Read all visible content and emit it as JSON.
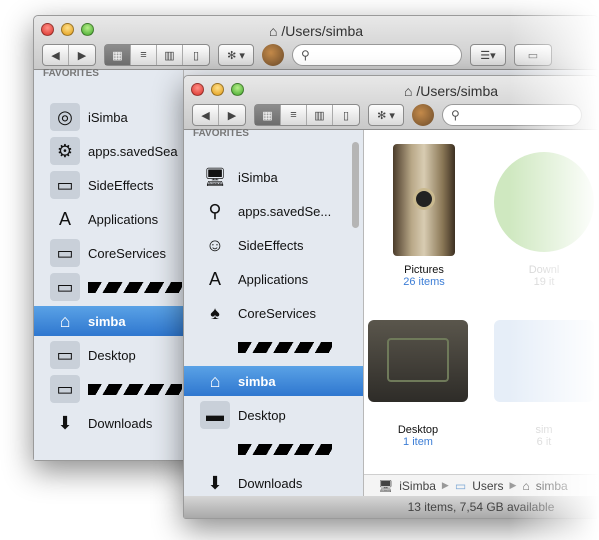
{
  "back_window": {
    "title": "/Users/simba",
    "search_placeholder": "",
    "favorites_label": "FAVORITES",
    "sidebar": [
      {
        "label": "iSimba",
        "icon": "hard-drive-icon"
      },
      {
        "label": "apps.savedSea",
        "icon": "gear-icon"
      },
      {
        "label": "SideEffects",
        "icon": "folder-icon"
      },
      {
        "label": "Applications",
        "icon": "applications-icon"
      },
      {
        "label": "CoreServices",
        "icon": "folder-icon"
      },
      {
        "label": "",
        "icon": "folder-icon"
      },
      {
        "label": "simba",
        "icon": "home-icon"
      },
      {
        "label": "Desktop",
        "icon": "desktop-icon"
      },
      {
        "label": "",
        "icon": "folder-icon"
      },
      {
        "label": "Downloads",
        "icon": "downloads-icon"
      }
    ]
  },
  "front_window": {
    "title": "/Users/simba",
    "favorites_label": "FAVORITES",
    "sidebar": [
      {
        "label": "iSimba",
        "icon": "imac-icon"
      },
      {
        "label": "apps.savedSe...",
        "icon": "magnifier-icon"
      },
      {
        "label": "SideEffects",
        "icon": "finder-icon"
      },
      {
        "label": "Applications",
        "icon": "applications-icon"
      },
      {
        "label": "CoreServices",
        "icon": "tuxedo-icon"
      },
      {
        "label": "",
        "icon": ""
      },
      {
        "label": "simba",
        "icon": "home-icon"
      },
      {
        "label": "Desktop",
        "icon": "desktop-folder-icon"
      },
      {
        "label": "",
        "icon": ""
      },
      {
        "label": "Downloads",
        "icon": "downloads-icon"
      }
    ],
    "files": [
      {
        "name": "Pictures",
        "count": "26 items"
      },
      {
        "name": "Downl",
        "count": "19 it"
      },
      {
        "name": "Desktop",
        "count": "1 item"
      },
      {
        "name": "sim",
        "count": "6 it"
      }
    ],
    "path": [
      "iSimba",
      "Users",
      "simba"
    ],
    "status": "13 items, 7,54 GB available"
  },
  "toolbar": {
    "back": "◀",
    "forward": "▶",
    "views": [
      "▦",
      "≡",
      "▥",
      "▯"
    ],
    "action": "✻ ▾",
    "search_icon": "⚲"
  },
  "selected_color": "#3a84d8"
}
